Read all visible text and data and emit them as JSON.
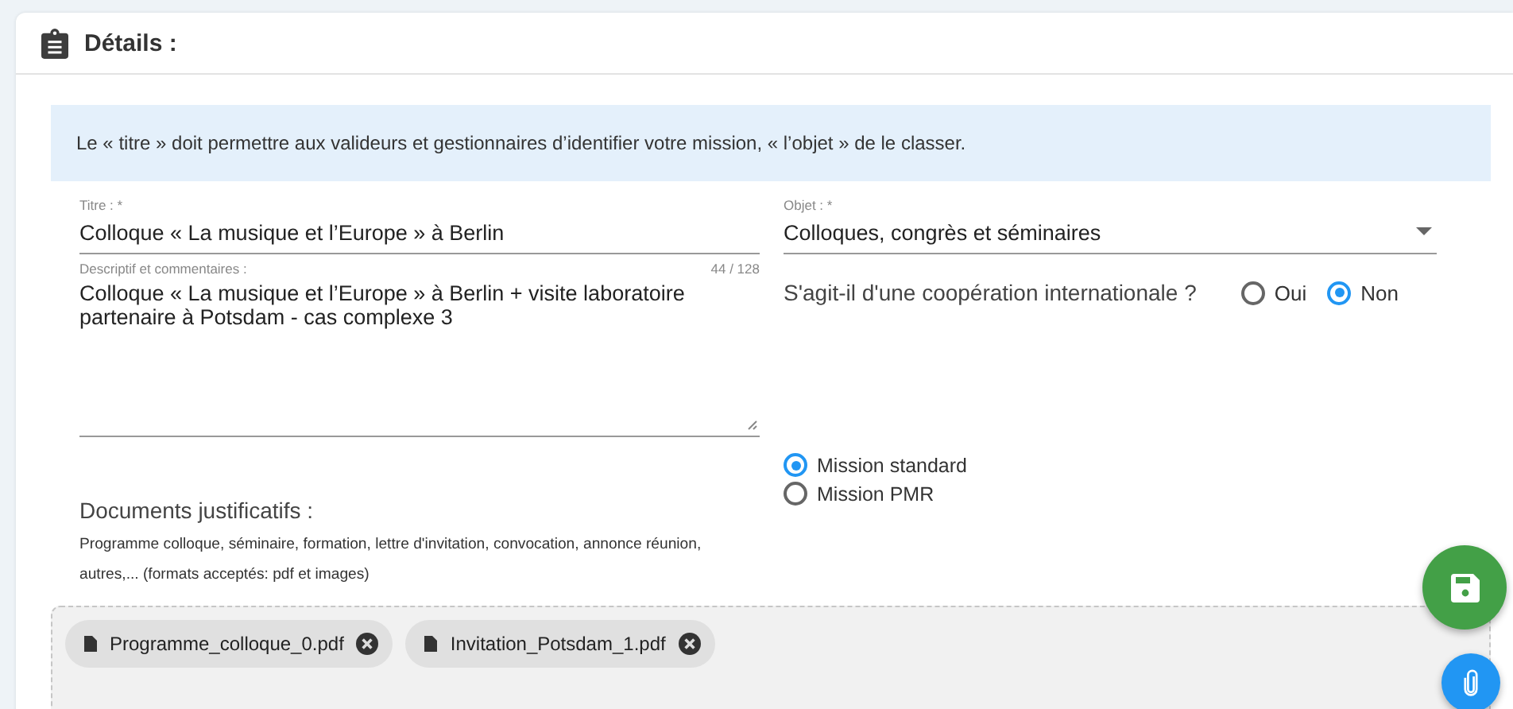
{
  "card": {
    "title": "Détails :"
  },
  "info": "Le « titre » doit permettre aux valideurs et gestionnaires d’identifier votre mission, « l’objet » de le classer.",
  "title_field": {
    "label": "Titre : *",
    "value": "Colloque « La musique et l’Europe » à Berlin"
  },
  "description_field": {
    "label": "Descriptif et commentaires :",
    "counter": "44 / 128",
    "value": "Colloque « La musique et l’Europe » à Berlin + visite laboratoire partenaire à Potsdam - cas complexe 3"
  },
  "object_field": {
    "label": "Objet : *",
    "value": "Colloques, congrès et séminaires"
  },
  "cooperation": {
    "question": "S'agit-il d'une coopération internationale ?",
    "options": [
      {
        "label": "Oui",
        "selected": false
      },
      {
        "label": "Non",
        "selected": true
      }
    ]
  },
  "mission_type": [
    {
      "label": "Mission standard",
      "selected": true
    },
    {
      "label": "Mission PMR",
      "selected": false
    }
  ],
  "documents": {
    "title": "Documents justificatifs :",
    "hint": "Programme colloque, séminaire, formation, lettre d'invitation, convocation, annonce réunion, autres,... (formats acceptés: pdf et images)",
    "files": [
      {
        "name": "Programme_colloque_0.pdf"
      },
      {
        "name": "Invitation_Potsdam_1.pdf"
      }
    ]
  }
}
